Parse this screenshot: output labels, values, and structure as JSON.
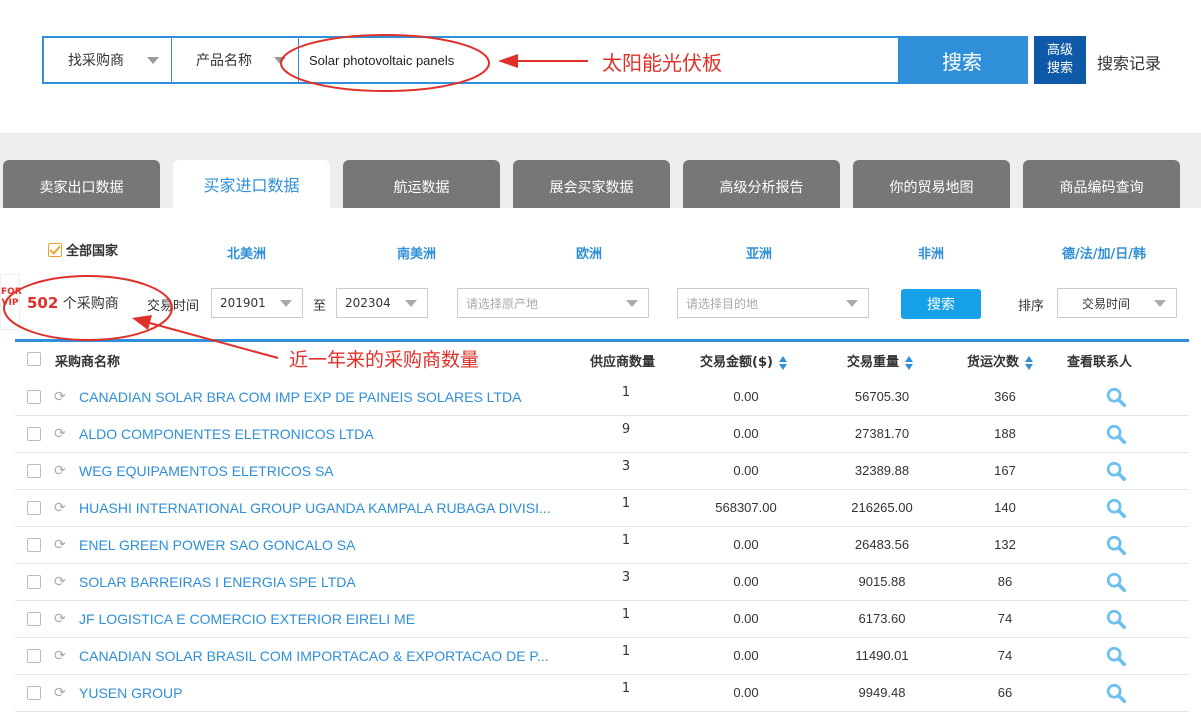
{
  "search": {
    "type_select": "找采购商",
    "field_select": "产品名称",
    "query": "Solar photovoltaic panels",
    "search_btn": "搜索",
    "advanced_btn_line1": "高级",
    "advanced_btn_line2": "搜索",
    "history_link": "搜索记录"
  },
  "tabs": [
    {
      "label": "卖家出口数据",
      "active": false
    },
    {
      "label": "买家进口数据",
      "active": true
    },
    {
      "label": "航运数据",
      "active": false
    },
    {
      "label": "展会买家数据",
      "active": false
    },
    {
      "label": "高级分析报告",
      "active": false
    },
    {
      "label": "你的贸易地图",
      "active": false
    },
    {
      "label": "商品编码查询",
      "active": false
    }
  ],
  "regions": {
    "all_countries": "全部国家",
    "items": [
      "北美洲",
      "南美洲",
      "欧洲",
      "亚洲",
      "非洲",
      "德/法/加/日/韩"
    ]
  },
  "filters": {
    "count_number": "502",
    "count_label": "个采购商",
    "vip_badge": "FOR VIP",
    "trade_time_label": "交易时间",
    "date_from": "201901",
    "to_label": "至",
    "date_to": "202304",
    "origin_placeholder": "请选择原产地",
    "destination_placeholder": "请选择目的地",
    "search_btn": "搜索",
    "sort_label": "排序",
    "sort_value": "交易时间"
  },
  "table": {
    "headers": {
      "name": "采购商名称",
      "suppliers": "供应商数量",
      "amount": "交易金额($)",
      "weight": "交易重量",
      "shipments": "货运次数",
      "contacts": "查看联系人"
    },
    "rows": [
      {
        "name": "CANADIAN SOLAR BRA COM IMP EXP DE PAINEIS SOLARES LTDA",
        "suppliers": "1",
        "amount": "0.00",
        "weight": "56705.30",
        "shipments": "366"
      },
      {
        "name": "ALDO COMPONENTES ELETRONICOS LTDA",
        "suppliers": "9",
        "amount": "0.00",
        "weight": "27381.70",
        "shipments": "188"
      },
      {
        "name": "WEG EQUIPAMENTOS ELETRICOS SA",
        "suppliers": "3",
        "amount": "0.00",
        "weight": "32389.88",
        "shipments": "167"
      },
      {
        "name": "HUASHI INTERNATIONAL GROUP UGANDA KAMPALA RUBAGA DIVISI...",
        "suppliers": "1",
        "amount": "568307.00",
        "weight": "216265.00",
        "shipments": "140"
      },
      {
        "name": "ENEL GREEN POWER SAO GONCALO SA",
        "suppliers": "1",
        "amount": "0.00",
        "weight": "26483.56",
        "shipments": "132"
      },
      {
        "name": "SOLAR BARREIRAS I ENERGIA SPE LTDA",
        "suppliers": "3",
        "amount": "0.00",
        "weight": "9015.88",
        "shipments": "86"
      },
      {
        "name": "JF LOGISTICA E COMERCIO EXTERIOR EIRELI ME",
        "suppliers": "1",
        "amount": "0.00",
        "weight": "6173.60",
        "shipments": "74"
      },
      {
        "name": "CANADIAN SOLAR BRASIL COM IMPORTACAO & EXPORTACAO DE P...",
        "suppliers": "1",
        "amount": "0.00",
        "weight": "11490.01",
        "shipments": "74"
      },
      {
        "name": "YUSEN GROUP",
        "suppliers": "1",
        "amount": "0.00",
        "weight": "9949.48",
        "shipments": "66"
      }
    ]
  },
  "annotations": {
    "solar_panels_cn": "太阳能光伏板",
    "buyer_count_note": "近一年来的采购商数量"
  },
  "colors": {
    "primary": "#2f8fd8",
    "dark_blue": "#0f5aa8",
    "annotation_red": "#e0302a",
    "tab_gray": "#777777"
  }
}
